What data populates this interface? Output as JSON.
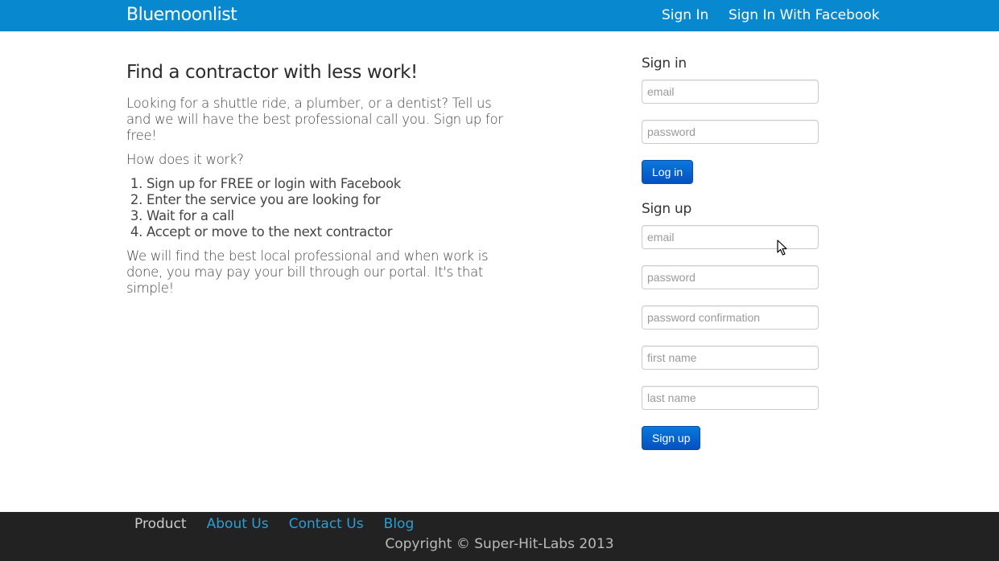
{
  "header": {
    "brand": "Bluemoonlist",
    "nav": {
      "sign_in": "Sign In",
      "sign_in_facebook": "Sign In With Facebook"
    }
  },
  "intro": {
    "title": "Find a contractor with less work!",
    "lead": "Looking for a shuttle ride, a plumber, or a dentist? Tell us and we will have the best professional call you. Sign up for free!",
    "how_heading": "How does it work?",
    "steps": [
      "Sign up for FREE or login with Facebook",
      "Enter the service you are looking for",
      "Wait for a call",
      "Accept or move to the next contractor"
    ],
    "closing": "We will find the best local professional and when work is done, you may pay your bill through our portal. It's that simple!"
  },
  "sign_in": {
    "heading": "Sign in",
    "email_placeholder": "email",
    "password_placeholder": "password",
    "button": "Log in"
  },
  "sign_up": {
    "heading": "Sign up",
    "email_placeholder": "email",
    "password_placeholder": "password",
    "password_confirmation_placeholder": "password confirmation",
    "first_name_placeholder": "first name",
    "last_name_placeholder": "last name",
    "button": "Sign up"
  },
  "footer": {
    "links": [
      "Product",
      "About Us",
      "Contact Us",
      "Blog"
    ],
    "copyright": "Copyright © Super-Hit-Labs 2013"
  },
  "colors": {
    "navbar": "#0888cf",
    "button": "#0551c2",
    "footer": "#222222",
    "footer_link": "#2a9fd6"
  }
}
